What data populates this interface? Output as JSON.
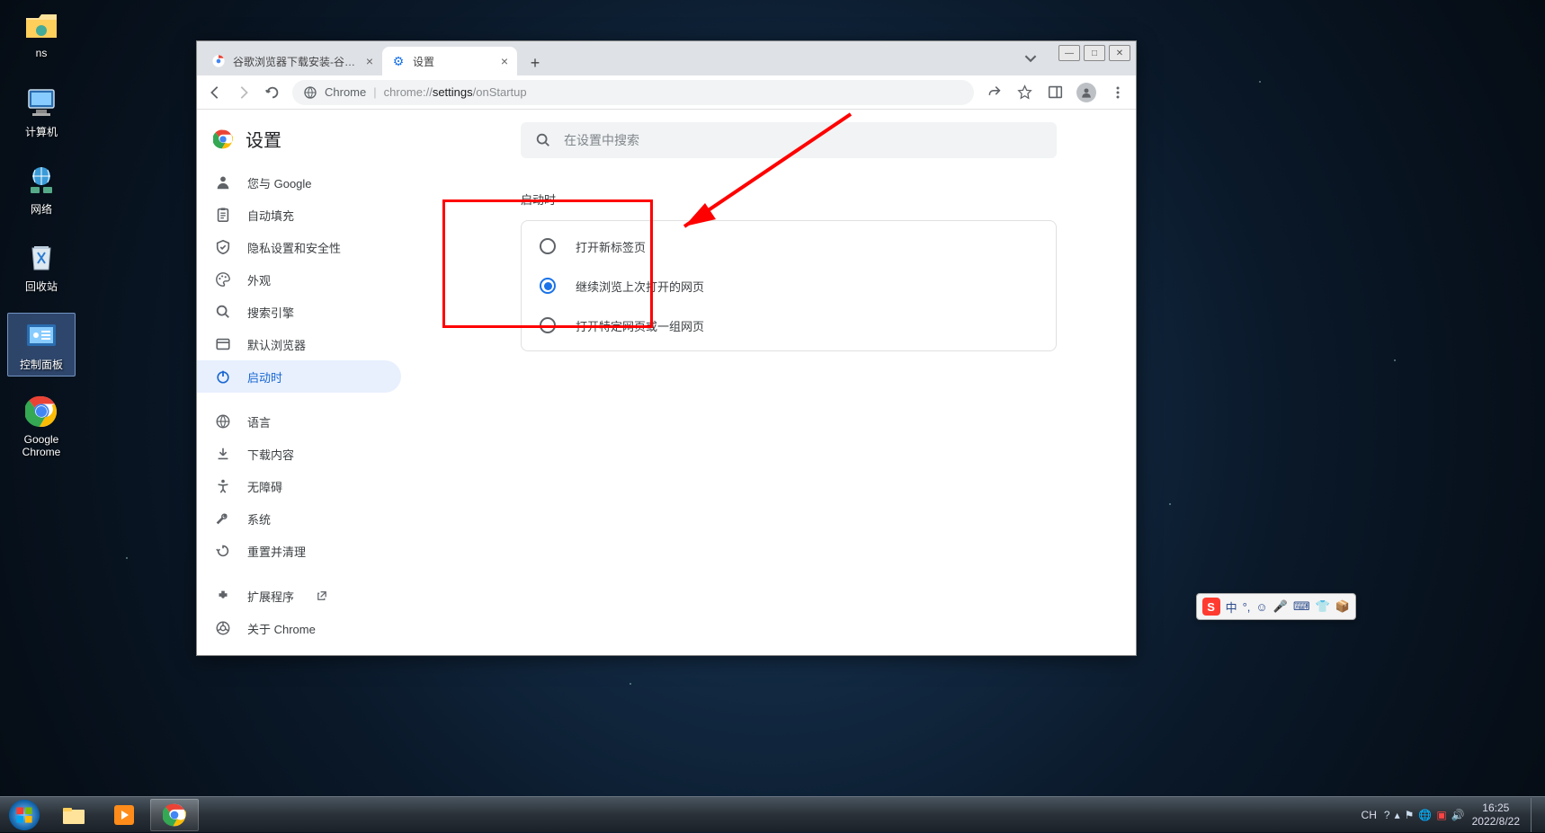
{
  "desktop": {
    "icons": [
      {
        "label": "ns"
      },
      {
        "label": "计算机"
      },
      {
        "label": "网络"
      },
      {
        "label": "回收站"
      },
      {
        "label": "控制面板"
      },
      {
        "label": "Google Chrome"
      }
    ]
  },
  "chrome": {
    "tabs": [
      {
        "title": "谷歌浏览器下载安装-谷歌浏览",
        "active": false
      },
      {
        "title": "设置",
        "active": true
      }
    ],
    "toolbar": {
      "site_label": "Chrome",
      "url_prefix": "chrome://",
      "url_highlight": "settings",
      "url_suffix": "/onStartup"
    },
    "settings": {
      "title": "设置",
      "search_placeholder": "在设置中搜索",
      "nav": [
        {
          "label": "您与 Google"
        },
        {
          "label": "自动填充"
        },
        {
          "label": "隐私设置和安全性"
        },
        {
          "label": "外观"
        },
        {
          "label": "搜索引擎"
        },
        {
          "label": "默认浏览器"
        },
        {
          "label": "启动时"
        }
      ],
      "nav2": [
        {
          "label": "语言"
        },
        {
          "label": "下载内容"
        },
        {
          "label": "无障碍"
        },
        {
          "label": "系统"
        },
        {
          "label": "重置并清理"
        }
      ],
      "nav3": [
        {
          "label": "扩展程序"
        },
        {
          "label": "关于 Chrome"
        }
      ],
      "section_title": "启动时",
      "options": [
        {
          "label": "打开新标签页",
          "checked": false
        },
        {
          "label": "继续浏览上次打开的网页",
          "checked": true
        },
        {
          "label": "打开特定网页或一组网页",
          "checked": false
        }
      ]
    }
  },
  "ime": {
    "lang": "中"
  },
  "taskbar": {
    "tray_label": "CH",
    "time": "16:25",
    "date": "2022/8/22"
  }
}
